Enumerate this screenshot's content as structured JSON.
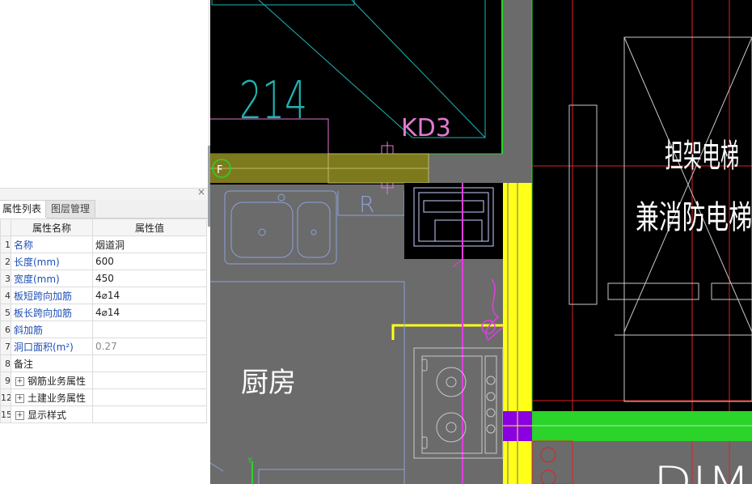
{
  "panel": {
    "close_label": "×",
    "tabs": [
      {
        "label": "属性列表",
        "active": true
      },
      {
        "label": "图层管理",
        "active": false
      }
    ]
  },
  "table": {
    "headers": [
      "属性名称",
      "属性值"
    ],
    "rows": [
      {
        "num": "1",
        "name": "名称",
        "value": "烟道洞"
      },
      {
        "num": "2",
        "name": "长度(mm)",
        "value": "600"
      },
      {
        "num": "3",
        "name": "宽度(mm)",
        "value": "450"
      },
      {
        "num": "4",
        "name": "板短跨向加筋",
        "value": "4⌀14"
      },
      {
        "num": "5",
        "name": "板长跨向加筋",
        "value": "4⌀14"
      },
      {
        "num": "6",
        "name": "斜加筋",
        "value": ""
      },
      {
        "num": "7",
        "name": "洞口面积(m²)",
        "value": "0.27"
      },
      {
        "num": "8",
        "name": "备注",
        "value": ""
      },
      {
        "num": "9",
        "name": "钢筋业务属性",
        "value": "",
        "expand": "+"
      },
      {
        "num": "12",
        "name": "土建业务属性",
        "value": "",
        "expand": "+"
      },
      {
        "num": "15",
        "name": "显示样式",
        "value": "",
        "expand": "+"
      }
    ]
  },
  "drawing": {
    "labels": {
      "room_number": "214",
      "kd3": "KD3",
      "axis_f": "F",
      "r_mark": "R",
      "kitchen": "厨房",
      "stretcher_elevator": "担架电梯",
      "fire_elevator": "兼消防电梯",
      "dim_fragment": "DIM",
      "y_axis": "Y"
    }
  }
}
